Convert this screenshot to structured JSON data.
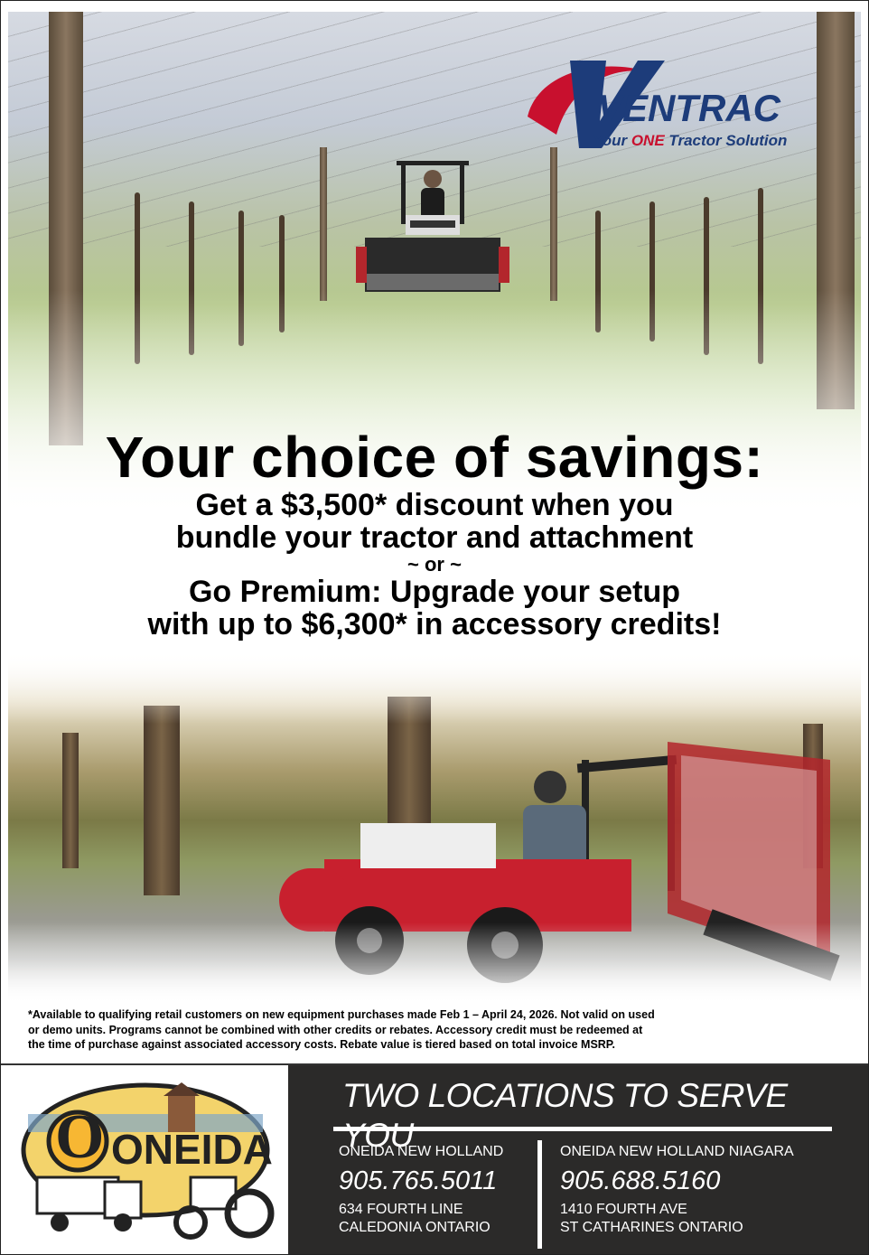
{
  "brand": {
    "name": "VENTRAC",
    "tagline_pre": "Your ",
    "tagline_em": "ONE",
    "tagline_post": " Tractor Solution",
    "colors": {
      "navy": "#1d3c7a",
      "red": "#c8102e"
    }
  },
  "headline": {
    "title": "Your choice of savings:",
    "line1": "Get a $3,500* discount when you",
    "line2": "bundle your tractor and attachment",
    "or": "~ or ~",
    "line3": "Go Premium: Upgrade your setup",
    "line4": "with up to $6,300* in accessory credits!"
  },
  "disclaimer": {
    "line1": "*Available to qualifying retail customers on new equipment purchases made Feb 1 – April 24, 2026. Not valid on used",
    "line2": "or demo units.  Programs cannot be combined with other credits or rebates. Accessory credit must be redeemed at",
    "line3": "the time of purchase against associated accessory costs. Rebate value is tiered based on total invoice MSRP."
  },
  "dealer": {
    "logo_text": "ONEIDA",
    "footer_title": "TWO LOCATIONS TO SERVE YOU",
    "locations": [
      {
        "name": "ONEIDA NEW HOLLAND",
        "phone": "905.765.5011",
        "address_line1": "634 FOURTH LINE",
        "address_line2": "CALEDONIA ONTARIO"
      },
      {
        "name": "ONEIDA NEW HOLLAND NIAGARA",
        "phone": "905.688.5160",
        "address_line1": "1410 FOURTH AVE",
        "address_line2": "ST CATHARINES ONTARIO"
      }
    ]
  }
}
